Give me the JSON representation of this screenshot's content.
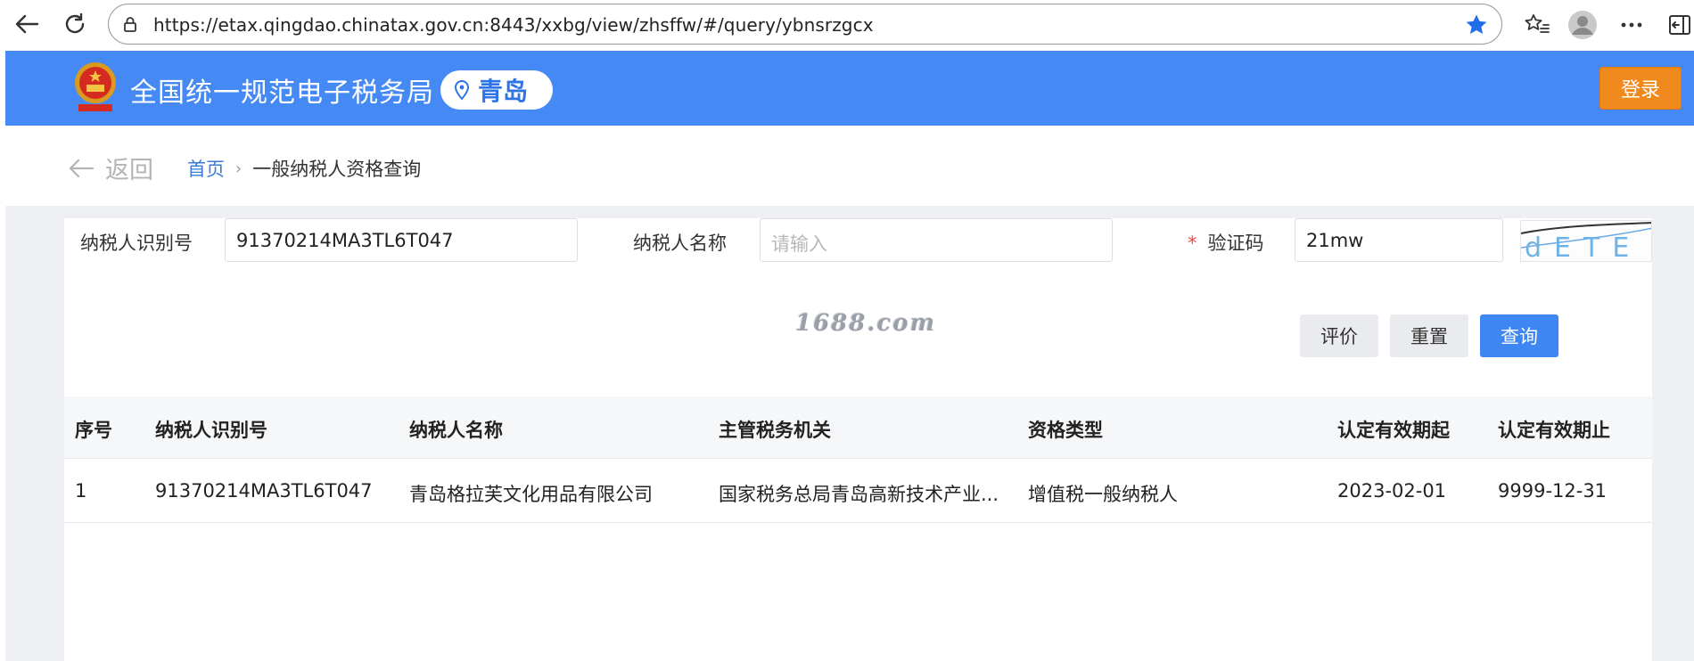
{
  "browser": {
    "url": "https://etax.qingdao.chinatax.gov.cn:8443/xxbg/view/zhsffw/#/query/ybnsrzgcx"
  },
  "header": {
    "title": "全国统一规范电子税务局",
    "region": "青岛",
    "login_label": "登录",
    "brand_color": "#4589f5",
    "login_color": "#f08a1d"
  },
  "breadcrumb": {
    "back_label": "返回",
    "home": "首页",
    "current": "一般纳税人资格查询"
  },
  "form": {
    "taxpayer_id_label": "纳税人识别号",
    "taxpayer_id_value": "91370214MA3TL6T047",
    "taxpayer_name_label": "纳税人名称",
    "taxpayer_name_placeholder": "请输入",
    "captcha_required_mark": "*",
    "captcha_label": "验证码",
    "captcha_value": "21mw",
    "captcha_image_text": "dETE",
    "watermark": "1688.com",
    "buttons": {
      "evaluate": "评价",
      "reset": "重置",
      "query": "查询"
    }
  },
  "table": {
    "columns": [
      "序号",
      "纳税人识别号",
      "纳税人名称",
      "主管税务机关",
      "资格类型",
      "认定有效期起",
      "认定有效期止"
    ],
    "rows": [
      [
        "1",
        "91370214MA3TL6T047",
        "青岛格拉芙文化用品有限公司",
        "国家税务总局青岛高新技术产业...",
        "增值税一般纳税人",
        "2023-02-01",
        "9999-12-31"
      ]
    ]
  }
}
